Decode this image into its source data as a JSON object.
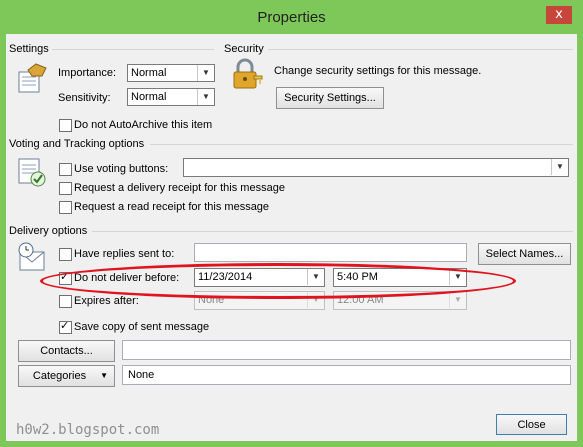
{
  "window": {
    "title": "Properties",
    "close_glyph": "x"
  },
  "settings": {
    "section_title": "Settings",
    "importance": {
      "label": "Importance:",
      "value": "Normal"
    },
    "sensitivity": {
      "label": "Sensitivity:",
      "value": "Normal"
    },
    "do_not_autoarchive": {
      "label": "Do not AutoArchive this item",
      "checked": false
    }
  },
  "security": {
    "section_title": "Security",
    "description": "Change security settings for this message.",
    "button_label": "Security Settings..."
  },
  "voting": {
    "section_title": "Voting and Tracking options",
    "use_voting_buttons": {
      "label": "Use voting buttons:",
      "checked": false,
      "value": ""
    },
    "delivery_receipt": {
      "label": "Request a delivery receipt for this message",
      "checked": false
    },
    "read_receipt": {
      "label": "Request a read receipt for this message",
      "checked": false
    }
  },
  "delivery": {
    "section_title": "Delivery options",
    "have_replies_sent_to": {
      "label": "Have replies sent to:",
      "checked": false,
      "value": ""
    },
    "select_names_label": "Select Names...",
    "do_not_deliver_before": {
      "label": "Do not deliver before:",
      "checked": true,
      "date": "11/23/2014",
      "time": "5:40 PM"
    },
    "expires_after": {
      "label": "Expires after:",
      "checked": false,
      "date": "None",
      "time": "12:00 AM"
    },
    "save_copy": {
      "label": "Save copy of sent message",
      "checked": true
    },
    "contacts_label": "Contacts...",
    "contacts_value": "",
    "categories_label": "Categories",
    "categories_value": "None"
  },
  "footer": {
    "close_label": "Close"
  },
  "watermark": "h0w2.blogspot.com",
  "colors": {
    "frame": "#7ec85a",
    "close_red": "#c7463a",
    "highlight_oval": "#e0141e"
  }
}
